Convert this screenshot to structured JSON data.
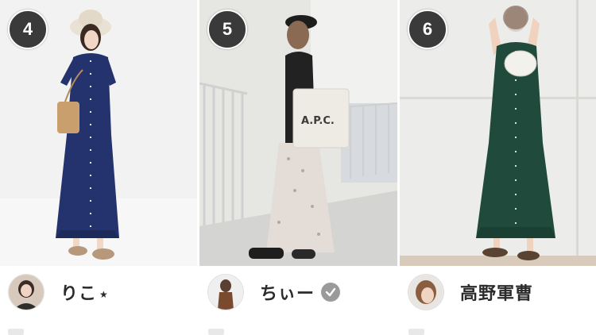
{
  "cards": [
    {
      "rank": "4",
      "username": "りこ",
      "badge_star": "★",
      "photo_colors": {
        "bg": "#f2f2f2",
        "dress": "#24336e"
      }
    },
    {
      "rank": "5",
      "username": "ちぃー",
      "verified": true,
      "photo_colors": {
        "bg": "#e6e6e3",
        "top": "#222222",
        "skirt": "#e4dcd6"
      }
    },
    {
      "rank": "6",
      "username": "高野軍曹",
      "photo_colors": {
        "bg": "#ececea",
        "dress": "#1f4a3c"
      }
    }
  ],
  "icons": [
    "check-verified-icon",
    "star-icon"
  ]
}
